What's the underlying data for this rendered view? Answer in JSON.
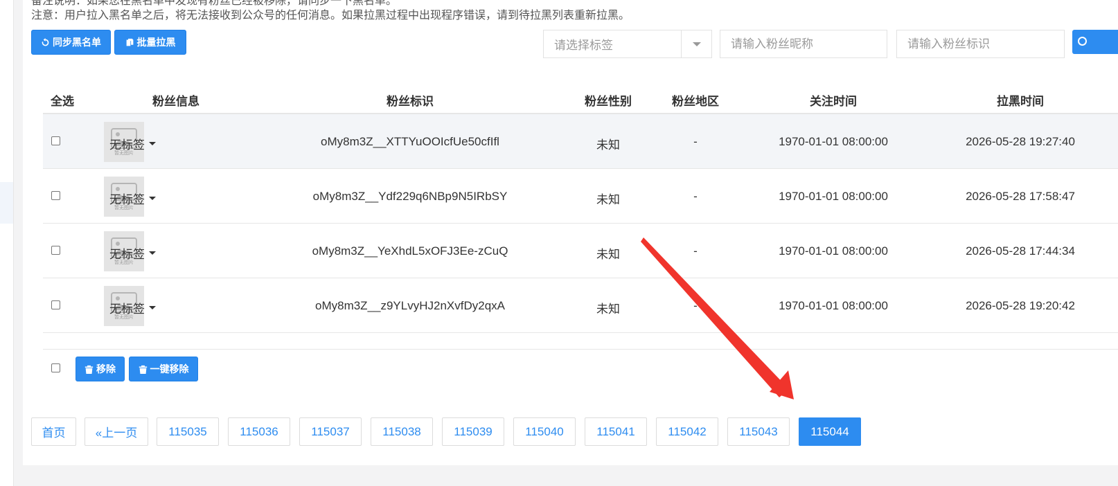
{
  "notes": {
    "line1": "备注说明：如果您在黑名单中发现有粉丝已经被移除，请同步一下黑名单。",
    "line2": "注意：用户拉入黑名单之后，将无法接收到公众号的任何消息。如果拉黑过程中出现程序错误，请到待拉黑列表重新拉黑。"
  },
  "toolbar": {
    "sync_label": "同步黑名单",
    "batch_label": "批量拉黑",
    "tag_select_placeholder": "请选择标签",
    "nickname_placeholder": "请输入粉丝昵称",
    "openid_placeholder": "请输入粉丝标识"
  },
  "table": {
    "headers": {
      "select_all": "全选",
      "fan_info": "粉丝信息",
      "fan_id": "粉丝标识",
      "gender": "粉丝性别",
      "region": "粉丝地区",
      "follow_time": "关注时间",
      "block_time": "拉黑时间"
    },
    "avatar_caption": "暂无图片",
    "rows": [
      {
        "tag": "无标签",
        "openid": "oMy8m3Z__XTTYuOOIcfUe50cfIfl",
        "gender": "未知",
        "region": "-",
        "follow_time": "1970-01-01 08:00:00",
        "block_time": "2026-05-28 19:27:40"
      },
      {
        "tag": "无标签",
        "openid": "oMy8m3Z__Ydf229q6NBp9N5IRbSY",
        "gender": "未知",
        "region": "-",
        "follow_time": "1970-01-01 08:00:00",
        "block_time": "2026-05-28 17:58:47"
      },
      {
        "tag": "无标签",
        "openid": "oMy8m3Z__YeXhdL5xOFJ3Ee-zCuQ",
        "gender": "未知",
        "region": "-",
        "follow_time": "1970-01-01 08:00:00",
        "block_time": "2026-05-28 17:44:34"
      },
      {
        "tag": "无标签",
        "openid": "oMy8m3Z__z9YLvyHJ2nXvfDy2qxA",
        "gender": "未知",
        "region": "-",
        "follow_time": "1970-01-01 08:00:00",
        "block_time": "2026-05-28 19:20:42"
      }
    ]
  },
  "footer": {
    "remove_label": "移除",
    "remove_all_label": "一键移除"
  },
  "pagination": {
    "first": "首页",
    "prev": "«上一页",
    "pages": [
      "115035",
      "115036",
      "115037",
      "115038",
      "115039",
      "115040",
      "115041",
      "115042",
      "115043",
      "115044"
    ],
    "current": "115044"
  },
  "colors": {
    "primary": "#2d8cf0",
    "arrow": "#f0342c",
    "row_highlight": "#f3f5f8"
  }
}
